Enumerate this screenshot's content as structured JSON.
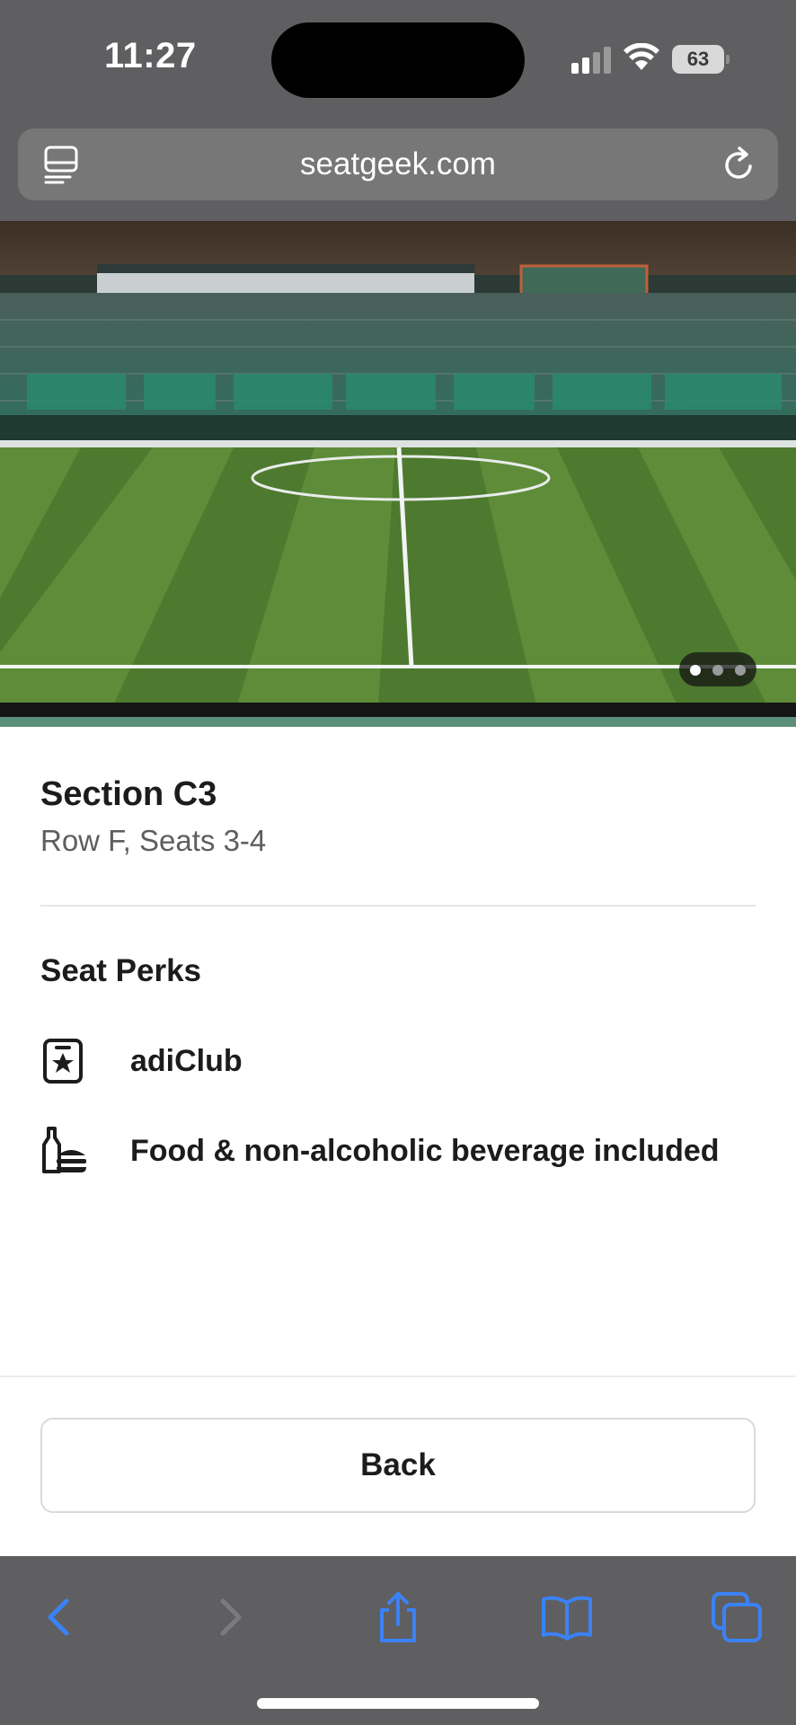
{
  "status_bar": {
    "time": "11:27",
    "battery_level": "63",
    "signal_icon": "cellular-signal-icon",
    "wifi_icon": "wifi-icon"
  },
  "browser": {
    "url": "seatgeek.com",
    "reader_icon": "reader-mode-icon",
    "reload_icon": "reload-icon"
  },
  "carousel": {
    "total_slides": 3,
    "active_slide": 1
  },
  "seat": {
    "section": "Section C3",
    "row_seats": "Row F, Seats 3-4"
  },
  "perks": {
    "title": "Seat Perks",
    "items": [
      {
        "label": "adiClub",
        "icon": "membership-card-icon"
      },
      {
        "label": "Food & non-alcoholic beverage included",
        "icon": "food-drink-icon"
      }
    ]
  },
  "footer": {
    "back_label": "Back"
  },
  "toolbar": {
    "items": [
      "back-arrow-icon",
      "forward-arrow-icon",
      "share-icon",
      "bookmarks-icon",
      "tabs-icon"
    ]
  },
  "colors": {
    "safari_chrome": "#5f5f61",
    "toolbar_accent": "#3b82f6",
    "text_primary": "#1c1c1e",
    "text_secondary": "#5e5e62"
  }
}
